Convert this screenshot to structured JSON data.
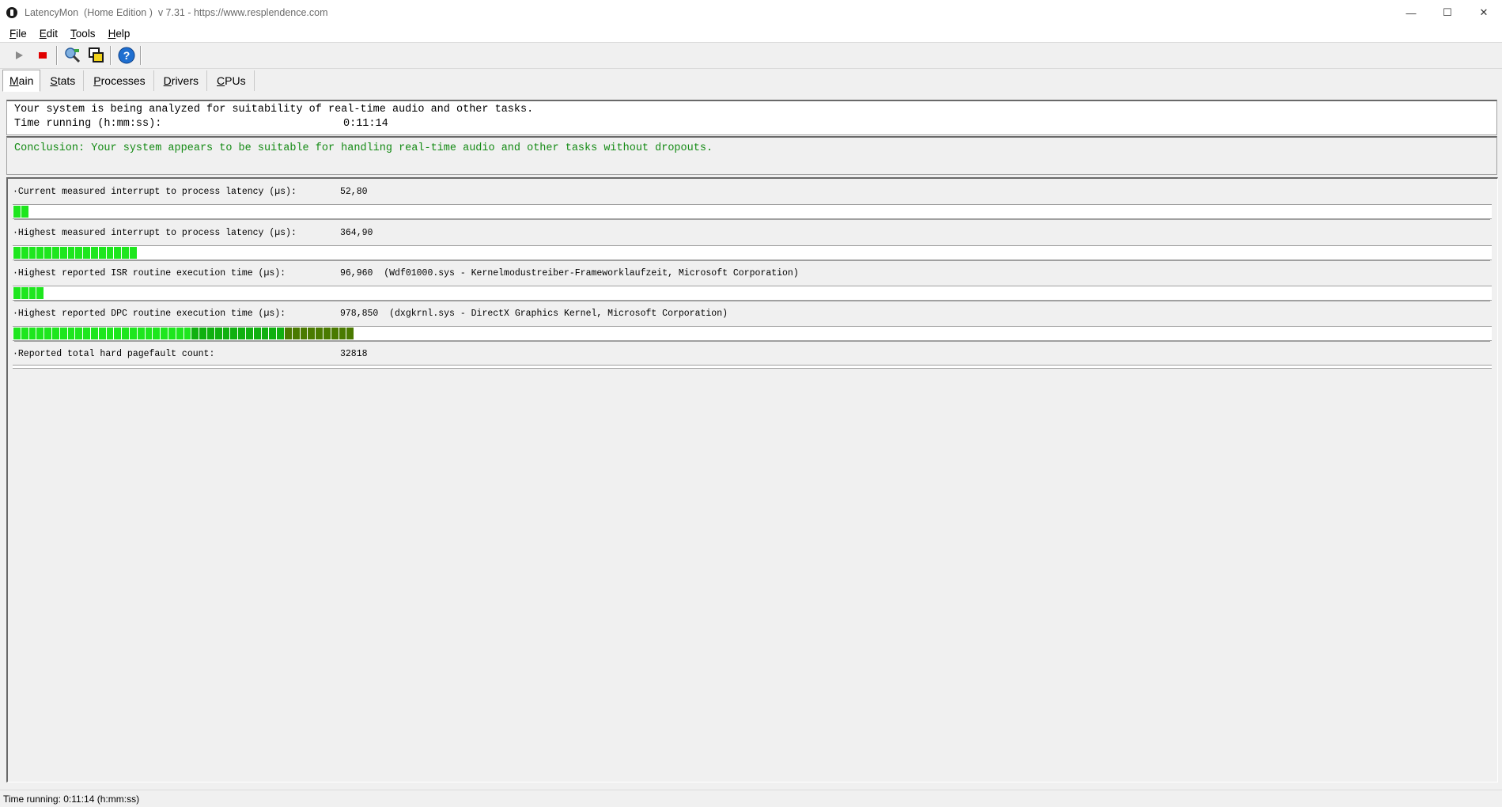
{
  "window": {
    "title": "LatencyMon  (Home Edition )  v 7.31 - https://www.resplendence.com",
    "minimize": "—",
    "maximize": "☐",
    "close": "✕"
  },
  "menu": [
    {
      "letter": "F",
      "rest": "ile"
    },
    {
      "letter": "E",
      "rest": "dit"
    },
    {
      "letter": "T",
      "rest": "ools"
    },
    {
      "letter": "H",
      "rest": "elp"
    }
  ],
  "toolbar": {
    "icons": [
      "play-icon",
      "stop-icon",
      "search-icon",
      "windows-icon",
      "help-icon"
    ],
    "colors": {
      "play": "#8a8a8a",
      "stop": "#e00000",
      "help": "#1f6fd0"
    }
  },
  "tabs": [
    {
      "letter": "M",
      "rest": "ain",
      "active": true
    },
    {
      "letter": "S",
      "rest": "tats",
      "active": false
    },
    {
      "letter": "P",
      "rest": "rocesses",
      "active": false
    },
    {
      "letter": "D",
      "rest": "rivers",
      "active": false
    },
    {
      "letter": "C",
      "rest": "PUs",
      "active": false
    }
  ],
  "summary": {
    "line1": "Your system is being analyzed for suitability of real-time audio and other tasks.",
    "time_label": "Time running (h:mm:ss):",
    "time_value": "0:11:14"
  },
  "conclusion": "Conclusion: Your system appears to be suitable for handling real-time audio and other tasks without dropouts.",
  "metrics": [
    {
      "label": "·Current measured interrupt to process latency (µs):",
      "value": "52,80",
      "extra": "",
      "level_fraction": 0.013,
      "segments": 2
    },
    {
      "label": "·Highest measured interrupt to process latency (µs):",
      "value": "364,90",
      "extra": "",
      "level_fraction": 0.102,
      "segments": 16
    },
    {
      "label": "·Highest reported ISR routine execution time (µs):",
      "value": "96,960",
      "extra": "(Wdf01000.sys - Kernelmodustreiber-Frameworklaufzeit, Microsoft Corporation)",
      "level_fraction": 0.025,
      "segments": 4
    },
    {
      "label": "·Highest reported DPC routine execution time (µs):",
      "value": "978,850",
      "extra": "(dxgkrnl.sys - DirectX Graphics Kernel, Microsoft Corporation)",
      "level_fraction": 0.282,
      "segments": 44
    },
    {
      "label": "·Reported total hard pagefault count:",
      "value": "32818",
      "extra": "",
      "level_fraction": 0,
      "segments": 0
    }
  ],
  "meter_colors": {
    "low": "#1ee61e",
    "mid": "#10b010",
    "high": "#4a7a00"
  },
  "statusbar": "Time running: 0:11:14  (h:mm:ss)"
}
